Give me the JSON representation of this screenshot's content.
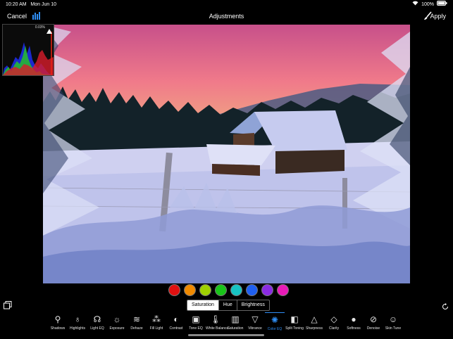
{
  "status_bar": {
    "time": "10:20 AM",
    "date": "Mon Jun 10",
    "battery": "100%"
  },
  "nav": {
    "cancel": "Cancel",
    "title": "Adjustments",
    "apply": "Apply"
  },
  "histogram": {
    "clip_percent": "0.03%"
  },
  "color_swatches": [
    "#e01010",
    "#f08a00",
    "#9fd100",
    "#19c419",
    "#17c3c3",
    "#1f5ff0",
    "#8a2be2",
    "#e81ab7"
  ],
  "segments": {
    "items": [
      "Saturation",
      "Hue",
      "Brightness"
    ],
    "active": "Saturation"
  },
  "tools": [
    {
      "label": "Shadows",
      "icon": "shadows-icon"
    },
    {
      "label": "Highlights",
      "icon": "highlights-icon"
    },
    {
      "label": "Light EQ",
      "icon": "light-eq-icon"
    },
    {
      "label": "Exposure",
      "icon": "exposure-icon"
    },
    {
      "label": "Dehaze",
      "icon": "dehaze-icon"
    },
    {
      "label": "Fill Light",
      "icon": "fill-light-icon"
    },
    {
      "label": "Contrast",
      "icon": "contrast-icon"
    },
    {
      "label": "Tone EQ",
      "icon": "tone-eq-icon"
    },
    {
      "label": "White Balance",
      "icon": "thermometer-icon"
    },
    {
      "label": "Saturation",
      "icon": "saturation-icon"
    },
    {
      "label": "Vibrance",
      "icon": "vibrance-icon"
    },
    {
      "label": "Color EQ",
      "icon": "color-eq-icon"
    },
    {
      "label": "Split Toning",
      "icon": "split-toning-icon"
    },
    {
      "label": "Sharpness",
      "icon": "sharpness-icon"
    },
    {
      "label": "Clarity",
      "icon": "clarity-icon"
    },
    {
      "label": "Softness",
      "icon": "softness-icon"
    },
    {
      "label": "Denoise",
      "icon": "denoise-icon"
    },
    {
      "label": "Skin Tune",
      "icon": "skin-tune-icon"
    }
  ],
  "active_tool": "Color EQ"
}
